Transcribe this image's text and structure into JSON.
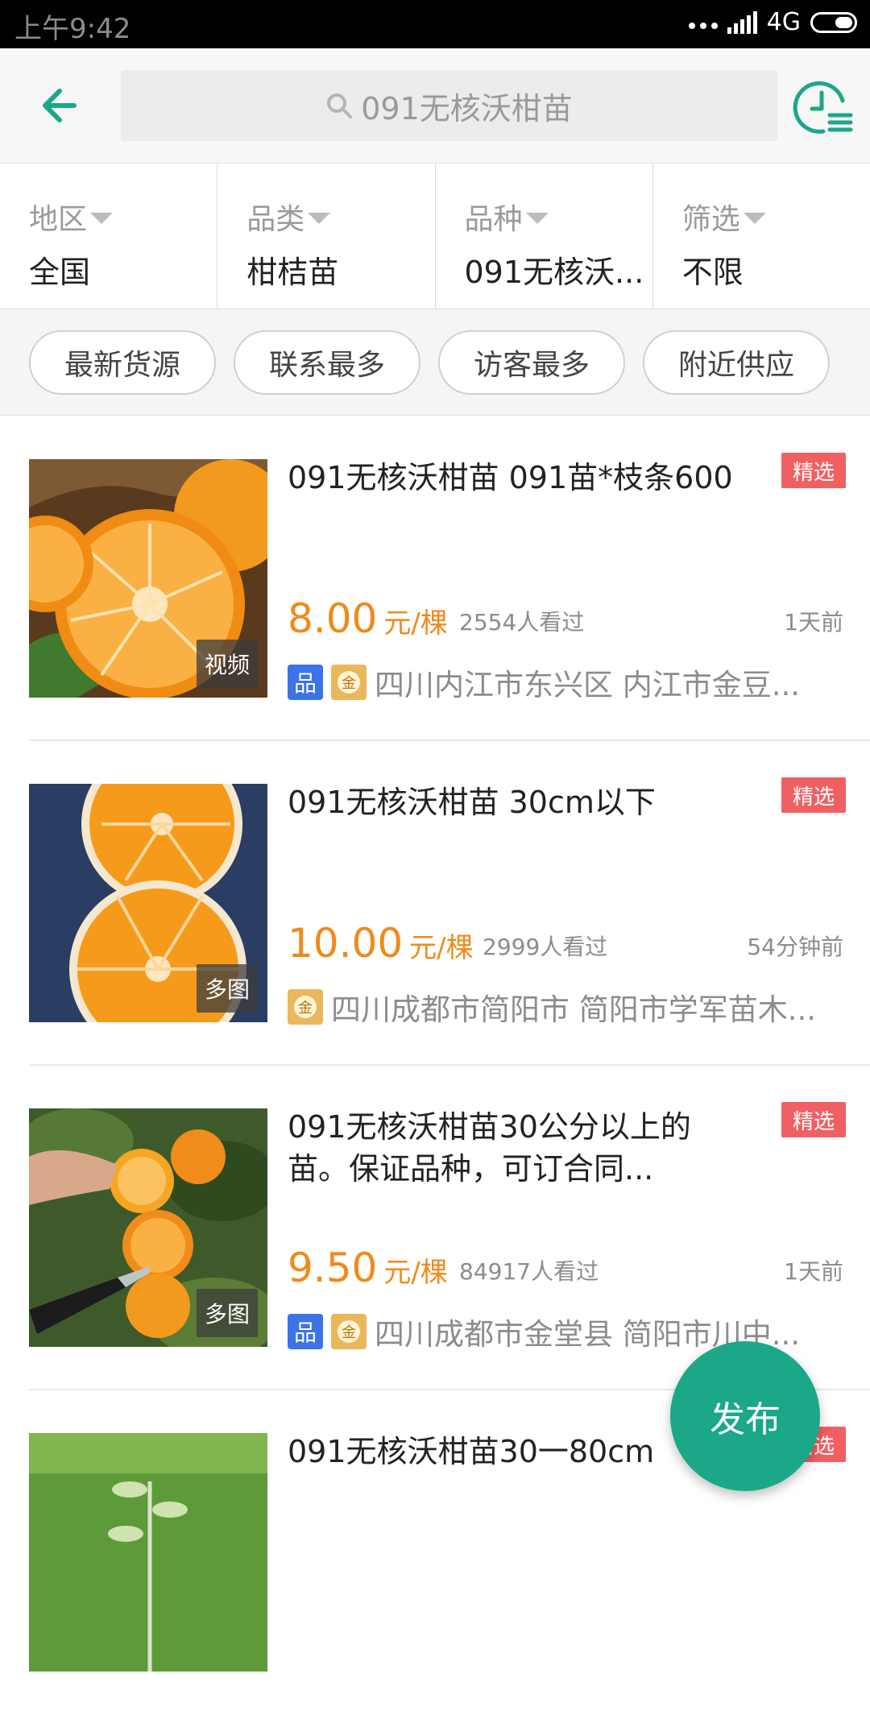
{
  "status_bar": {
    "time": "上午9:42",
    "network": "4G"
  },
  "search": {
    "query": "091无核沃柑苗"
  },
  "filters": [
    {
      "label": "地区",
      "value": "全国"
    },
    {
      "label": "品类",
      "value": "柑桔苗"
    },
    {
      "label": "品种",
      "value": "091无核沃..."
    },
    {
      "label": "筛选",
      "value": "不限"
    }
  ],
  "sort_chips": [
    "最新货源",
    "联系最多",
    "访客最多",
    "附近供应"
  ],
  "listings": [
    {
      "title": "091无核沃柑苗 091苗*枝条600",
      "badge": "精选",
      "price": "8.00",
      "unit": "元/棵",
      "views": "2554人看过",
      "time": "1天前",
      "location": "四川内江市东兴区 内江市金豆...",
      "thumb_tag": "视频",
      "has_pin_icon": true
    },
    {
      "title": "091无核沃柑苗 30cm以下",
      "badge": "精选",
      "price": "10.00",
      "unit": "元/棵",
      "views": "2999人看过",
      "time": "54分钟前",
      "location": "四川成都市简阳市 简阳市学军苗木...",
      "thumb_tag": "多图",
      "has_pin_icon": false
    },
    {
      "title": "091无核沃柑苗30公分以上的苗。保证品种，可订合同...",
      "badge": "精选",
      "price": "9.50",
      "unit": "元/棵",
      "views": "84917人看过",
      "time": "1天前",
      "location": "四川成都市金堂县 简阳市川中...",
      "thumb_tag": "多图",
      "has_pin_icon": true
    },
    {
      "title": "091无核沃柑苗30一80cm",
      "badge": "精选"
    }
  ],
  "fab": {
    "label": "发布"
  },
  "colors": {
    "accent": "#1aa889",
    "price": "#f08a1a",
    "badge": "#f06062"
  }
}
